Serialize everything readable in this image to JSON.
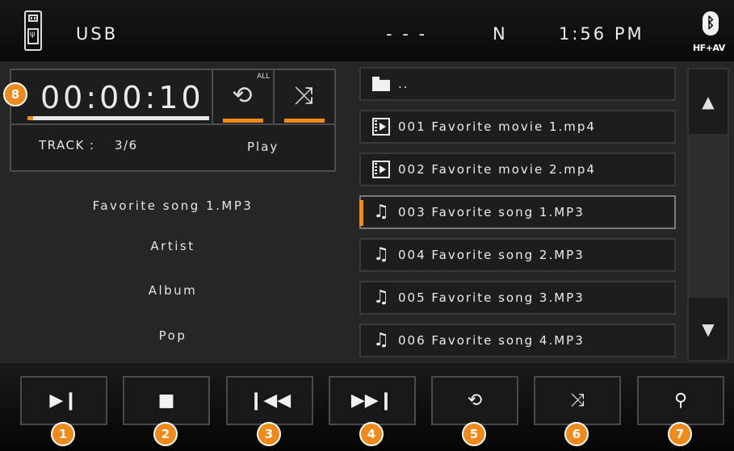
{
  "header": {
    "source": "USB",
    "status": "- - -",
    "band": "N",
    "clock": "1:56 PM",
    "bluetooth_label": "HF+AV",
    "icons": {
      "source": "usb-drive-icon",
      "bluetooth": "bluetooth-icon"
    }
  },
  "player": {
    "elapsed": "00:00:10",
    "progress_fraction": 0.03,
    "repeat_mode_label": "ALL",
    "track_label": "TRACK :",
    "track_value": "3/6",
    "state": "Play",
    "song": "Favorite song 1.MP3",
    "artist": "Artist",
    "album": "Album",
    "genre": "Pop"
  },
  "files": [
    {
      "name": "..",
      "type": "folder-icon",
      "selected": false
    },
    {
      "name": "001 Favorite movie 1.mp4",
      "type": "movie-icon",
      "selected": false
    },
    {
      "name": "002 Favorite movie 2.mp4",
      "type": "movie-icon",
      "selected": false
    },
    {
      "name": "003 Favorite song 1.MP3",
      "type": "music-note-icon",
      "selected": true
    },
    {
      "name": "004 Favorite song 2.MP3",
      "type": "music-note-icon",
      "selected": false
    },
    {
      "name": "005 Favorite song 3.MP3",
      "type": "music-note-icon",
      "selected": false
    },
    {
      "name": "006 Favorite song 4.MP3",
      "type": "music-note-icon",
      "selected": false
    }
  ],
  "scroll": {
    "up_icon": "scroll-up-icon",
    "down_icon": "scroll-down-icon"
  },
  "controls": [
    {
      "icon": "play-pause-icon",
      "glyph": "▶❙",
      "badge": "1"
    },
    {
      "icon": "stop-icon",
      "glyph": "■",
      "badge": "2"
    },
    {
      "icon": "previous-track-icon",
      "glyph": "❙◀◀",
      "badge": "3"
    },
    {
      "icon": "next-track-icon",
      "glyph": "▶▶❙",
      "badge": "4"
    },
    {
      "icon": "repeat-icon",
      "glyph": "⟲",
      "badge": "5"
    },
    {
      "icon": "shuffle-icon",
      "glyph": "⤨",
      "badge": "6"
    },
    {
      "icon": "search-icon",
      "glyph": "⚲",
      "badge": "7"
    }
  ],
  "callout_badge": "8",
  "colors": {
    "accent": "#f08a1a",
    "panel": "#262626",
    "background": "#000000"
  }
}
